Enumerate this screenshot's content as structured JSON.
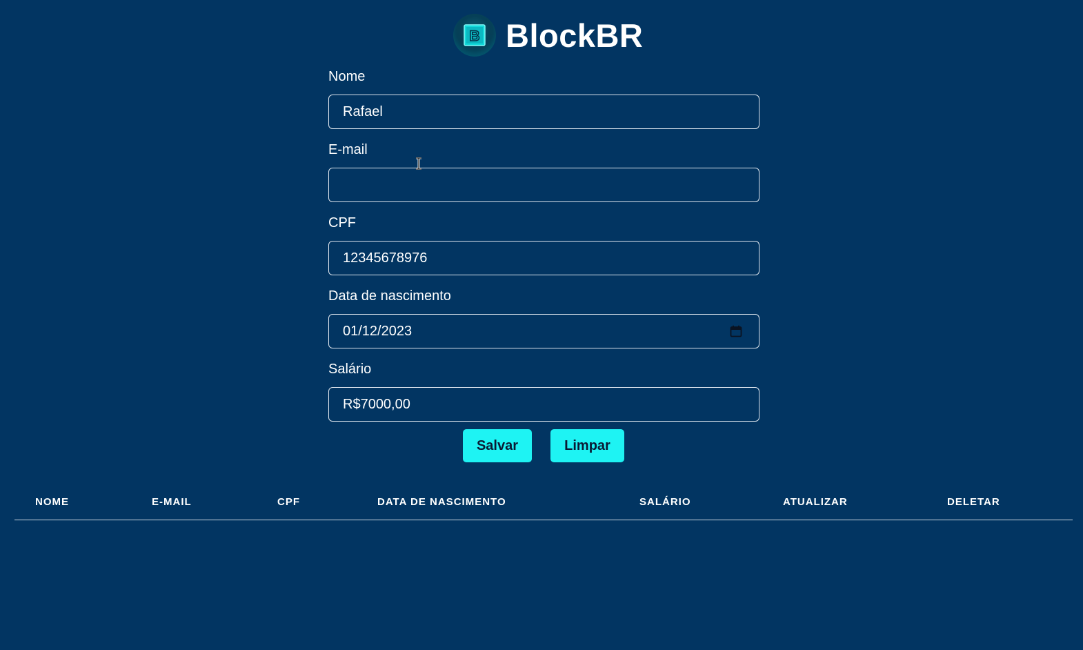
{
  "brand": {
    "name": "BlockBR",
    "logo_letter": "B",
    "accent": "#1ef3f3",
    "background": "#023562"
  },
  "form": {
    "fields": [
      {
        "label": "Nome",
        "value": "Rafael"
      },
      {
        "label": "E-mail",
        "value": ""
      },
      {
        "label": "CPF",
        "value": "12345678976"
      },
      {
        "label": "Data de nascimento",
        "value": "01/12/2023",
        "icon": "calendar-icon"
      },
      {
        "label": "Salário",
        "value": "R$7000,00"
      }
    ]
  },
  "buttons": {
    "save": "Salvar",
    "clear": "Limpar"
  },
  "table": {
    "headers": [
      "NOME",
      "E-MAIL",
      "CPF",
      "DATA DE NASCIMENTO",
      "SALÁRIO",
      "ATUALIZAR",
      "DELETAR"
    ],
    "rows": []
  }
}
